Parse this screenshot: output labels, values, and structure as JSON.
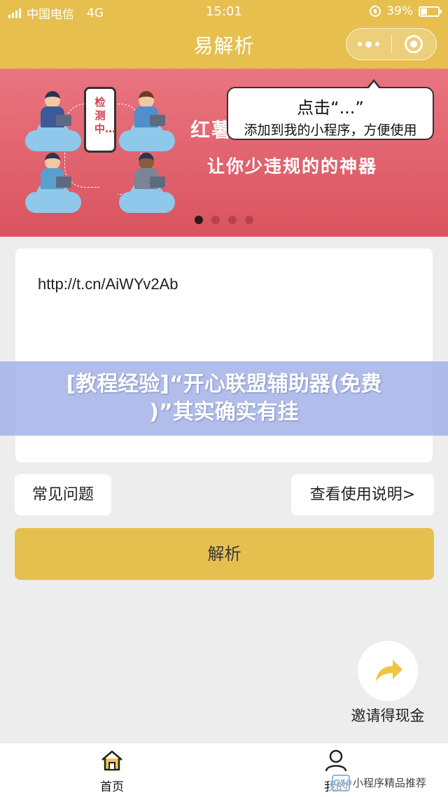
{
  "status_bar": {
    "carrier": "中国电信",
    "network": "4G",
    "time": "15:01",
    "battery": "39%",
    "battery_level": 0.39
  },
  "nav": {
    "title": "易解析"
  },
  "banner": {
    "line1": "红薯",
    "line2": "让你少违规的的神器",
    "phone_text": "检测中…",
    "tip_title": "点击“...”",
    "tip_sub": "添加到我的小程序，方便使用",
    "slide_count": 4,
    "active_slide": 0
  },
  "input": {
    "value": "http://t.cn/AiWYv2Ab"
  },
  "caption": {
    "line1": "[教程经验]“开心联盟辅助器(免费",
    "line2": ")”其实确实有挂"
  },
  "links": {
    "faq": "常见问题",
    "guide": "查看使用说明>"
  },
  "parse_button": "解析",
  "invite": {
    "label": "邀请得现金"
  },
  "tabs": [
    {
      "label": "首页"
    },
    {
      "label": "我的"
    }
  ],
  "watermark": {
    "logo": "G50",
    "text": "小程序精品推荐"
  },
  "colors": {
    "accent": "#e6c04f",
    "banner": "#dd5c67",
    "background": "#ededee"
  }
}
